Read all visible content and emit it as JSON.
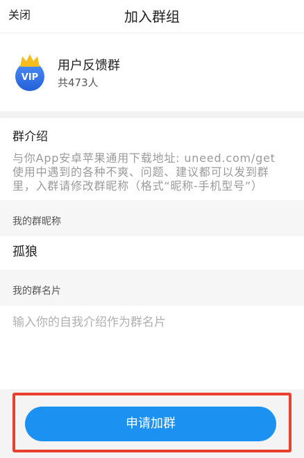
{
  "header": {
    "close_label": "关闭",
    "title": "加入群组"
  },
  "group": {
    "icon": "vip-crown-icon",
    "badge_text": "VIP",
    "name": "用户反馈群",
    "member_count": "共473人"
  },
  "intro": {
    "title": "群介绍",
    "description": "与你App安卓苹果通用下载地址: uneed.com/get\n使用中遇到的各种不爽、问题、建议都可以发到群\n里，入群请修改群昵称（格式“昵称-手机型号”）"
  },
  "nickname": {
    "label": "我的群昵称",
    "value": "孤狼"
  },
  "card": {
    "label": "我的群名片",
    "placeholder": "输入你的自我介绍作为群名片"
  },
  "footer": {
    "apply_label": "申请加群"
  },
  "colors": {
    "accent": "#1b92f2",
    "highlight": "#e8402c",
    "badge": "#2f6fe0",
    "crown": "#f6bd1f"
  }
}
